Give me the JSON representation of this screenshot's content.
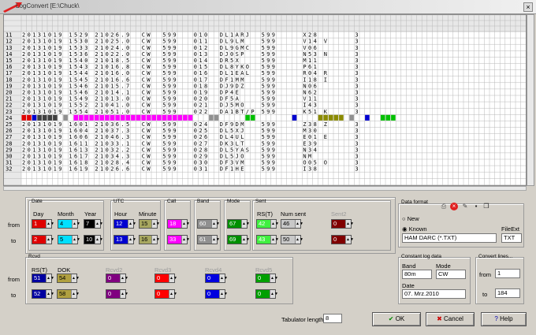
{
  "window": {
    "title": "LogConvert [E:\\Chuck\\"
  },
  "grid": {
    "row_numbers": [
      "11",
      "12",
      "13",
      "14",
      "15",
      "16",
      "17",
      "18",
      "19",
      "20",
      "21",
      "22",
      "23",
      "24",
      "25",
      "26",
      "27",
      "28",
      "29",
      "30",
      "31",
      "32"
    ],
    "rows": [
      [
        "20131019",
        "1529",
        "21026.9",
        "CW",
        "599",
        "010",
        "DL1ARJ",
        "599",
        "X28",
        "",
        "3"
      ],
      [
        "20131019",
        "1530",
        "21025.0",
        "CW",
        "599",
        "011",
        "DL9LM",
        "599",
        "V14",
        "V",
        "3"
      ],
      [
        "20131019",
        "1533",
        "21024.0",
        "CW",
        "599",
        "012",
        "DL9GMC",
        "599",
        "V06",
        "",
        "3"
      ],
      [
        "20131019",
        "1536",
        "21022.0",
        "CW",
        "599",
        "013",
        "DJ0SP",
        "599",
        "N53",
        "N",
        "3"
      ],
      [
        "20131019",
        "1540",
        "21018.5",
        "CW",
        "599",
        "014",
        "DR5X",
        "599",
        "M11",
        "",
        "3"
      ],
      [
        "20131019",
        "1543",
        "21016.8",
        "CW",
        "599",
        "015",
        "DL8YKO",
        "599",
        "P61",
        "",
        "3"
      ],
      [
        "20131019",
        "1544",
        "21016.0",
        "CW",
        "599",
        "016",
        "DL1EAL",
        "599",
        "R04",
        "R",
        "3"
      ],
      [
        "20131019",
        "1545",
        "21016.6",
        "CW",
        "599",
        "017",
        "DF1MM",
        "599",
        "I18",
        "I",
        "3"
      ],
      [
        "20131019",
        "1546",
        "21015.7",
        "CW",
        "599",
        "018",
        "DJ9DZ",
        "599",
        "N06",
        "",
        "3"
      ],
      [
        "20131019",
        "1546",
        "21014.1",
        "CW",
        "599",
        "019",
        "DP4E",
        "599",
        "N62",
        "",
        "3"
      ],
      [
        "20131019",
        "1549",
        "21013.0",
        "CW",
        "599",
        "020",
        "DF5A",
        "599",
        "V11",
        "",
        "3"
      ],
      [
        "20131019",
        "1552",
        "21041.0",
        "CW",
        "599",
        "021",
        "DJ5MO",
        "599",
        "I43",
        "",
        "3"
      ],
      [
        "20131019",
        "1554",
        "21051.0",
        "CW",
        "599",
        "022",
        "DA1BT/P",
        "599",
        "K51",
        "K",
        "3"
      ],
      [
        "",
        "",
        "",
        "",
        "",
        "",
        "",
        "",
        "",
        "",
        ""
      ],
      [
        "20131019",
        "1601",
        "21036.5",
        "CW",
        "599",
        "024",
        "DF9DM",
        "599",
        "Z38",
        "Z",
        "3"
      ],
      [
        "20131019",
        "1604",
        "21037.3",
        "CW",
        "599",
        "025",
        "DL5XJ",
        "599",
        "M30",
        "",
        "3"
      ],
      [
        "20131019",
        "1606",
        "21046.3",
        "CW",
        "599",
        "026",
        "DL4UL",
        "599",
        "E01",
        "E",
        "3"
      ],
      [
        "20131019",
        "1611",
        "21033.1",
        "CW",
        "599",
        "027",
        "DK3LT",
        "599",
        "E39",
        "",
        "3"
      ],
      [
        "20131019",
        "1613",
        "21032.2",
        "CW",
        "599",
        "028",
        "DL5YAS",
        "599",
        "N34",
        "",
        "3"
      ],
      [
        "20131019",
        "1617",
        "21034.3",
        "CW",
        "599",
        "029",
        "DL5JO",
        "599",
        "NM",
        "",
        "3"
      ],
      [
        "20131019",
        "1618",
        "21028.4",
        "CW",
        "599",
        "030",
        "DF3VM",
        "599",
        "O05",
        "O",
        "3"
      ],
      [
        "20131019",
        "1619",
        "21026.6",
        "CW",
        "599",
        "031",
        "DF1HE",
        "599",
        "I38",
        "",
        "3"
      ]
    ],
    "colors": {
      "red": "#e00000",
      "blue": "#0000d0",
      "magenta": "#ff00ff",
      "grey": "#909090",
      "olive": "#8a8a00",
      "green": "#00c000",
      "dark": "#404040"
    }
  },
  "date": {
    "title": "Date",
    "day": "Day",
    "month": "Month",
    "year": "Year"
  },
  "utc": {
    "title": "UTC",
    "hour": "Hour",
    "minute": "Minute"
  },
  "call": {
    "title": "Call"
  },
  "band": {
    "title": "Band"
  },
  "mode": {
    "title": "Mode"
  },
  "sent": {
    "title": "Sent",
    "rst": "RS(T)",
    "num": "Num sent",
    "sent2": "Sent2"
  },
  "rcvd": {
    "title": "Rcvd",
    "rst": "RS(T)",
    "dok": "DOK",
    "r2": "Rcvd2",
    "r3": "Rcvd3",
    "r4": "Rcvd4",
    "r5": "Rcvd5"
  },
  "rows": {
    "from": "from",
    "to": "to"
  },
  "from_vals": {
    "day": "1",
    "month": "4",
    "year": "7",
    "hour": "12",
    "minute": "15",
    "call": "18",
    "band": "60",
    "mode": "67",
    "rst": "42",
    "num": "46",
    "sent2": "0"
  },
  "to_vals": {
    "day": "2",
    "month": "5",
    "year": "10",
    "hour": "13",
    "minute": "16",
    "call": "33",
    "band": "61",
    "mode": "69",
    "rst": "43",
    "num": "50",
    "sent2": "0"
  },
  "rcvd_from": {
    "rst": "51",
    "dok": "54",
    "r2": "0",
    "r3": "0",
    "r4": "0",
    "r5": "0"
  },
  "rcvd_to": {
    "rst": "52",
    "dok": "58",
    "r2": "0",
    "r3": "0",
    "r4": "0",
    "r5": "0"
  },
  "data_format": {
    "title": "Data format",
    "new": "New",
    "known": "Known",
    "format": "HAM DARC (*.TXT)",
    "fileext_label": "FileExt",
    "fileext": "TXT"
  },
  "constant": {
    "title": "Constant log data",
    "band_label": "Band",
    "band": "80m",
    "mode_label": "Mode",
    "mode": "CW",
    "date_label": "Date",
    "date": "07. Mrz.2010"
  },
  "convert": {
    "title": "Convert lines...",
    "from_label": "from",
    "from": "1",
    "to_label": "to",
    "to": "184"
  },
  "tab": {
    "label": "Tabulator length",
    "value": "8"
  },
  "buttons": {
    "ok": "OK",
    "cancel": "Cancel",
    "help": "Help"
  }
}
